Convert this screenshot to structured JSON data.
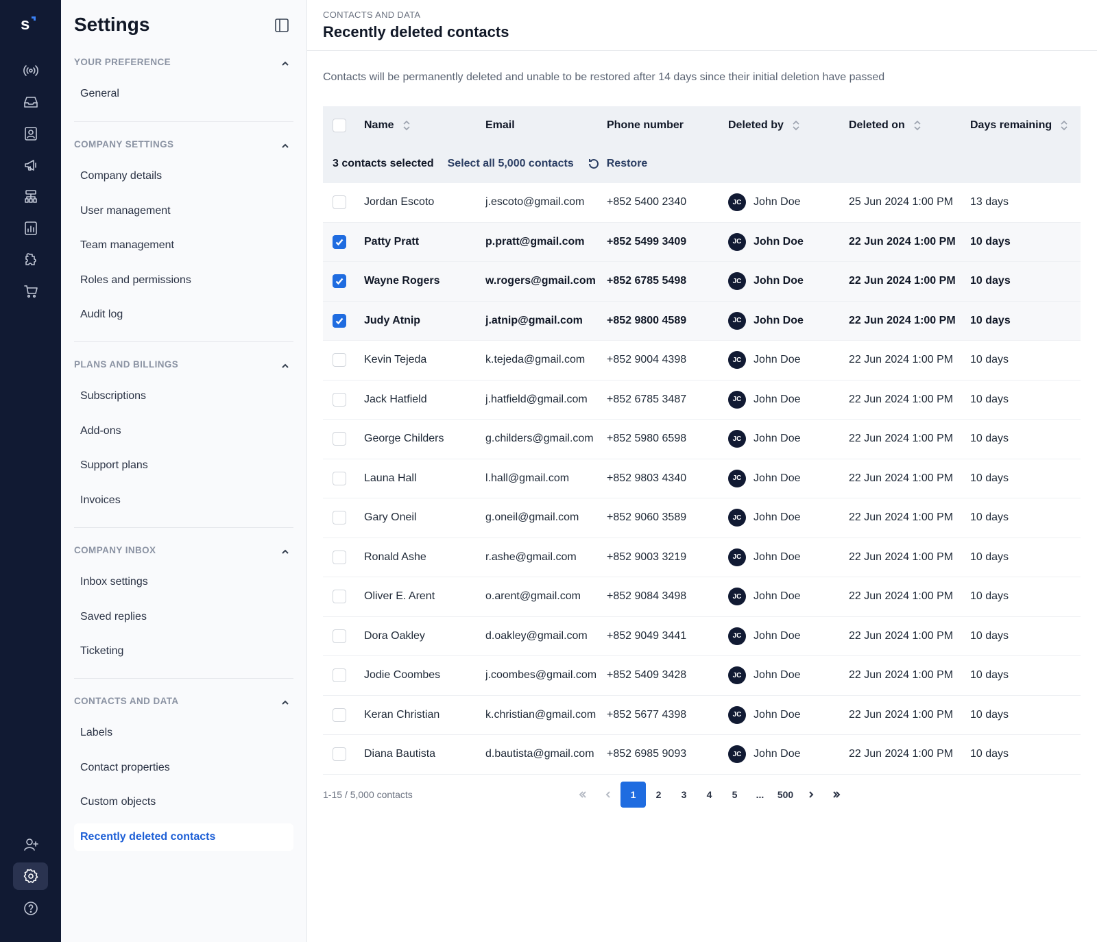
{
  "brand": {
    "logo_letter": "s"
  },
  "sidebar": {
    "title": "Settings",
    "sections": [
      {
        "heading": "YOUR PREFERENCE",
        "items": [
          "General"
        ]
      },
      {
        "heading": "COMPANY SETTINGS",
        "items": [
          "Company details",
          "User management",
          "Team management",
          "Roles and permissions",
          "Audit log"
        ]
      },
      {
        "heading": "PLANS AND BILLINGS",
        "items": [
          "Subscriptions",
          "Add-ons",
          "Support plans",
          "Invoices"
        ]
      },
      {
        "heading": "COMPANY INBOX",
        "items": [
          "Inbox settings",
          "Saved replies",
          "Ticketing"
        ]
      },
      {
        "heading": "CONTACTS AND DATA",
        "items": [
          "Labels",
          "Contact properties",
          "Custom objects",
          "Recently deleted contacts"
        ]
      }
    ],
    "active_item": "Recently deleted contacts"
  },
  "header": {
    "breadcrumb": "CONTACTS AND DATA",
    "title": "Recently deleted contacts"
  },
  "notice": "Contacts will be permanently deleted and unable to be restored after 14 days since their initial deletion have passed",
  "table": {
    "columns": {
      "name": "Name",
      "email": "Email",
      "phone": "Phone number",
      "deleted_by": "Deleted by",
      "deleted_on": "Deleted on",
      "days": "Days remaining"
    },
    "selection": {
      "count_label": "3 contacts selected",
      "select_all_label": "Select all 5,000 contacts",
      "restore_label": "Restore"
    },
    "rows": [
      {
        "name": "Jordan Escoto",
        "email": "j.escoto@gmail.com",
        "phone": "+852 5400 2340",
        "initials": "JC",
        "by": "John Doe",
        "on": "25 Jun 2024 1:00 PM",
        "days": "13 days",
        "selected": false
      },
      {
        "name": "Patty Pratt",
        "email": "p.pratt@gmail.com",
        "phone": "+852 5499 3409",
        "initials": "JC",
        "by": "John Doe",
        "on": "22 Jun 2024 1:00 PM",
        "days": "10 days",
        "selected": true
      },
      {
        "name": "Wayne Rogers",
        "email": "w.rogers@gmail.com",
        "phone": "+852 6785 5498",
        "initials": "JC",
        "by": "John Doe",
        "on": "22 Jun 2024 1:00 PM",
        "days": "10 days",
        "selected": true
      },
      {
        "name": "Judy Atnip",
        "email": "j.atnip@gmail.com",
        "phone": "+852 9800 4589",
        "initials": "JC",
        "by": "John Doe",
        "on": "22 Jun 2024 1:00 PM",
        "days": "10 days",
        "selected": true
      },
      {
        "name": "Kevin Tejeda",
        "email": "k.tejeda@gmail.com",
        "phone": "+852 9004 4398",
        "initials": "JC",
        "by": "John Doe",
        "on": "22 Jun 2024 1:00 PM",
        "days": "10 days",
        "selected": false
      },
      {
        "name": "Jack Hatfield",
        "email": "j.hatfield@gmail.com",
        "phone": "+852 6785 3487",
        "initials": "JC",
        "by": "John Doe",
        "on": "22 Jun 2024 1:00 PM",
        "days": "10 days",
        "selected": false
      },
      {
        "name": "George Childers",
        "email": "g.childers@gmail.com",
        "phone": "+852 5980 6598",
        "initials": "JC",
        "by": "John Doe",
        "on": "22 Jun 2024 1:00 PM",
        "days": "10 days",
        "selected": false
      },
      {
        "name": "Launa Hall",
        "email": "l.hall@gmail.com",
        "phone": "+852 9803 4340",
        "initials": "JC",
        "by": "John Doe",
        "on": "22 Jun 2024 1:00 PM",
        "days": "10 days",
        "selected": false
      },
      {
        "name": "Gary Oneil",
        "email": "g.oneil@gmail.com",
        "phone": "+852 9060 3589",
        "initials": "JC",
        "by": "John Doe",
        "on": "22 Jun 2024 1:00 PM",
        "days": "10 days",
        "selected": false
      },
      {
        "name": "Ronald Ashe",
        "email": "r.ashe@gmail.com",
        "phone": "+852 9003 3219",
        "initials": "JC",
        "by": "John Doe",
        "on": "22 Jun 2024 1:00 PM",
        "days": "10 days",
        "selected": false
      },
      {
        "name": "Oliver E. Arent",
        "email": "o.arent@gmail.com",
        "phone": "+852 9084 3498",
        "initials": "JC",
        "by": "John Doe",
        "on": "22 Jun 2024 1:00 PM",
        "days": "10 days",
        "selected": false
      },
      {
        "name": "Dora Oakley",
        "email": "d.oakley@gmail.com",
        "phone": "+852 9049 3441",
        "initials": "JC",
        "by": "John Doe",
        "on": "22 Jun 2024 1:00 PM",
        "days": "10 days",
        "selected": false
      },
      {
        "name": "Jodie Coombes",
        "email": "j.coombes@gmail.com",
        "phone": "+852 5409 3428",
        "initials": "JC",
        "by": "John Doe",
        "on": "22 Jun 2024 1:00 PM",
        "days": "10 days",
        "selected": false
      },
      {
        "name": "Keran Christian",
        "email": "k.christian@gmail.com",
        "phone": "+852 5677 4398",
        "initials": "JC",
        "by": "John Doe",
        "on": "22 Jun 2024 1:00 PM",
        "days": "10 days",
        "selected": false
      },
      {
        "name": "Diana Bautista",
        "email": "d.bautista@gmail.com",
        "phone": "+852 6985 9093",
        "initials": "JC",
        "by": "John Doe",
        "on": "22 Jun 2024 1:00 PM",
        "days": "10 days",
        "selected": false
      }
    ]
  },
  "pagination": {
    "range_label": "1-15 / 5,000 contacts",
    "pages": [
      "1",
      "2",
      "3",
      "4",
      "5",
      "...",
      "500"
    ],
    "current": "1"
  },
  "rail": {
    "top_icons": [
      "broadcast-icon",
      "inbox-icon",
      "contacts-icon",
      "megaphone-icon",
      "workflow-icon",
      "reports-icon",
      "integrations-icon",
      "cart-icon"
    ],
    "bottom_icons": [
      "invite-user-icon",
      "settings-icon",
      "help-icon"
    ],
    "active": "settings-icon"
  },
  "colors": {
    "rail_bg": "#111a33",
    "accent": "#1f6ce0",
    "active_nav": "#1d5fd6"
  }
}
